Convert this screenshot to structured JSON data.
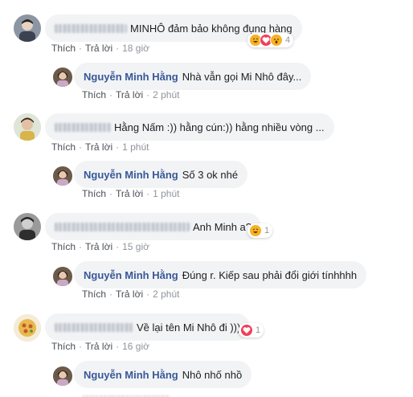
{
  "labels": {
    "like": "Thích",
    "reply": "Trả lời",
    "sep": "·"
  },
  "comments": [
    {
      "author_blurred": true,
      "text": "MINHÔ đảm bảo không đụng hàng",
      "time": "18 giờ",
      "reactions": [
        "haha-icon",
        "love-icon",
        "wow-icon"
      ],
      "reaction_count": "4",
      "reply": {
        "author": "Nguyễn Minh Hằng",
        "text": "Nhà vẫn gọi Mi Nhô đây...",
        "time": "2 phút"
      }
    },
    {
      "author_blurred": true,
      "text": "Hằng Nấm :)) hằng cún:)) hằng nhiều vòng ...",
      "time": "1 phút",
      "reactions": [],
      "reaction_count": "",
      "reply": {
        "author": "Nguyễn Minh Hằng",
        "text": "Số 3 ok nhé",
        "time": "1 phút"
      }
    },
    {
      "author_blurred": true,
      "text": "Anh Minh a?",
      "time": "15 giờ",
      "reactions": [
        "haha-icon"
      ],
      "reaction_count": "1",
      "reply": {
        "author": "Nguyễn Minh Hằng",
        "text": "Đúng r. Kiếp sau phải đổi giới tínhhhh",
        "time": "2 phút"
      }
    },
    {
      "author_blurred": true,
      "text": "Về lại tên Mi Nhô đi )))",
      "time": "16 giờ",
      "reactions": [
        "love-icon"
      ],
      "reaction_count": "1",
      "reply": {
        "author": "Nguyễn Minh Hằng",
        "text": "Nhô nhố nhồ",
        "time": ""
      }
    }
  ],
  "colors": {
    "bubble": "#f2f3f5",
    "name": "#385898",
    "meta": "#90949c",
    "love": "#f33e58",
    "haha": "#f7b125"
  }
}
